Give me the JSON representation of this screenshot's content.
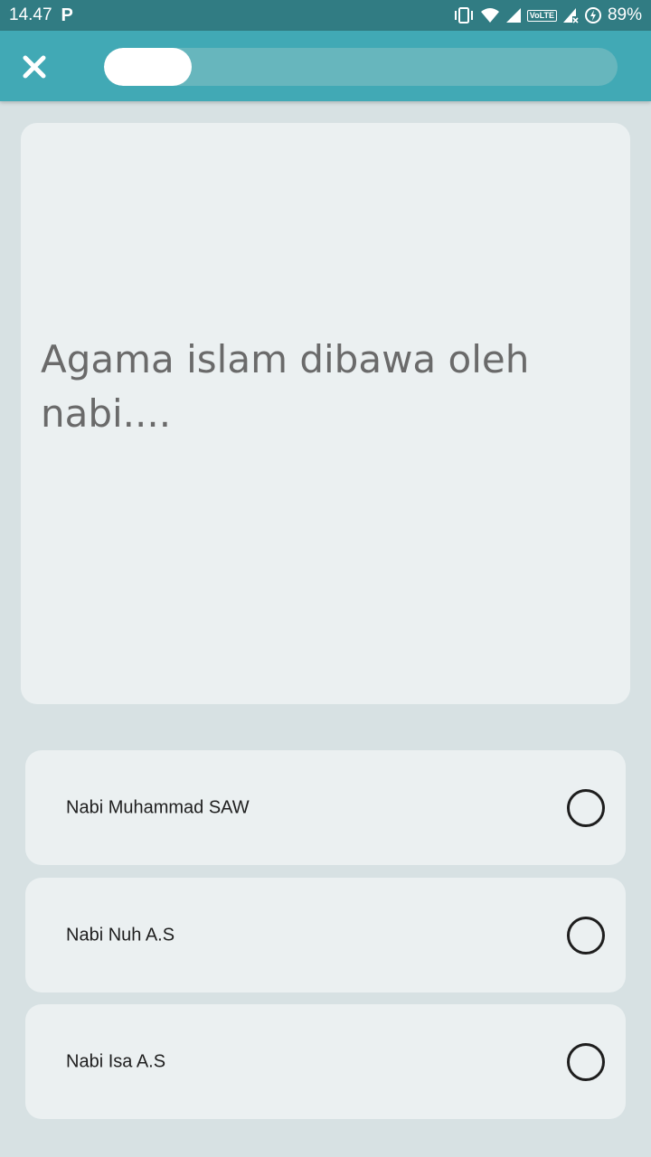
{
  "status_bar": {
    "time": "14.47",
    "notification_icon": "P",
    "network_badge": "VoLTE",
    "battery": "89%",
    "icons": [
      "vibrate-icon",
      "wifi-icon",
      "signal-icon",
      "volte-icon",
      "signal-no-data-icon",
      "battery-saver-icon"
    ]
  },
  "header": {
    "close_icon": "close-icon",
    "progress_fraction": 0.17
  },
  "question": {
    "text": "Agama islam dibawa oleh nabi...."
  },
  "options": [
    {
      "label": "Nabi Muhammad SAW",
      "selected": false
    },
    {
      "label": "Nabi Nuh A.S",
      "selected": false
    },
    {
      "label": "Nabi Isa A.S",
      "selected": false
    }
  ],
  "colors": {
    "status_bar": "#317c83",
    "app_bar": "#41a9b5",
    "progress_track": "#67b6bd",
    "progress_fill": "#ffffff",
    "background": "#d7e1e3",
    "card": "#ebf0f1"
  }
}
